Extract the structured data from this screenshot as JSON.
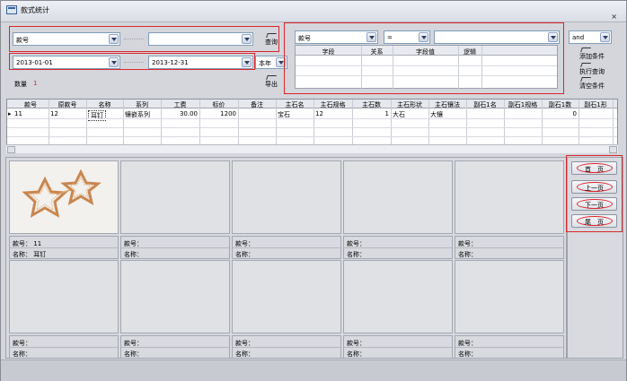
{
  "window": {
    "title": "款式统计"
  },
  "search": {
    "field_select": "款号",
    "value_select": "",
    "query_label": "查询",
    "date_from": "2013-01-01",
    "date_to": "2013-12-31",
    "period_select": "本年",
    "export_label": "导出",
    "count_label": "数量",
    "count_value": "1"
  },
  "conditions": {
    "field": "款号",
    "operator": "=",
    "value": "",
    "logic": "and",
    "columns": [
      "字段",
      "关系",
      "字段值",
      "逻辑"
    ],
    "add_label": "添加条件",
    "run_label": "执行查询",
    "clear_label": "清空条件"
  },
  "grid": {
    "columns": [
      "款号",
      "原款号",
      "名称",
      "系列",
      "工费",
      "标价",
      "备注",
      "主石名",
      "主石规格",
      "主石数",
      "主石形状",
      "主石镶法",
      "副石1名",
      "副石1规格",
      "副石1数",
      "副石1形"
    ],
    "rows": [
      [
        "11",
        "12",
        "耳钉",
        "镶嵌系列",
        "30.00",
        "1200",
        "",
        "宝石",
        "12",
        "1",
        "大石",
        "大镶",
        "",
        "",
        "0",
        ""
      ]
    ]
  },
  "cards": [
    {
      "code_label": "款号：",
      "code": "11",
      "name_label": "名称：",
      "name": "耳钉",
      "has_image": true
    },
    {
      "code_label": "款号：",
      "code": "",
      "name_label": "名称：",
      "name": ""
    },
    {
      "code_label": "款号：",
      "code": "",
      "name_label": "名称：",
      "name": ""
    },
    {
      "code_label": "款号：",
      "code": "",
      "name_label": "名称：",
      "name": ""
    },
    {
      "code_label": "款号：",
      "code": "",
      "name_label": "名称：",
      "name": ""
    },
    {
      "code_label": "款号：",
      "code": "",
      "name_label": "名称：",
      "name": ""
    },
    {
      "code_label": "款号：",
      "code": "",
      "name_label": "名称：",
      "name": ""
    },
    {
      "code_label": "款号：",
      "code": "",
      "name_label": "名称：",
      "name": ""
    },
    {
      "code_label": "款号：",
      "code": "",
      "name_label": "名称：",
      "name": ""
    },
    {
      "code_label": "款号：",
      "code": "",
      "name_label": "名称：",
      "name": ""
    }
  ],
  "pager": {
    "first": "首　页",
    "prev": "上一页",
    "next": "下一页",
    "last": "尾　页"
  },
  "colors": {
    "highlight": "#d9262b",
    "count": "#d9262b"
  }
}
